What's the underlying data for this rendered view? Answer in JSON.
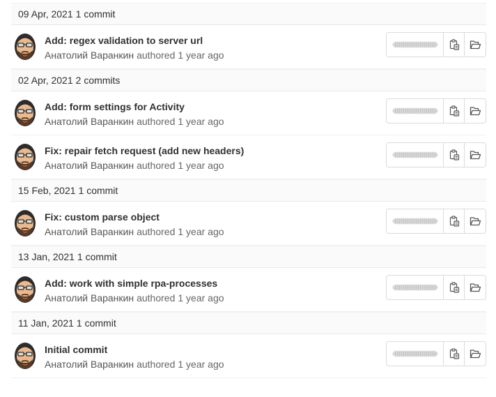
{
  "commit_list": {
    "days": [
      {
        "date": "09 Apr, 2021",
        "count_label": "1 commit",
        "commits": [
          {
            "title": "Add: regex validation to server url",
            "author": "Анатолий Варанкин",
            "verb": "authored",
            "time": "1 year ago"
          }
        ]
      },
      {
        "date": "02 Apr, 2021",
        "count_label": "2 commits",
        "commits": [
          {
            "title": "Add: form settings for Activity",
            "author": "Анатолий Варанкин",
            "verb": "authored",
            "time": "1 year ago"
          },
          {
            "title": "Fix: repair fetch request (add new headers)",
            "author": "Анатолий Варанкин",
            "verb": "authored",
            "time": "1 year ago"
          }
        ]
      },
      {
        "date": "15 Feb, 2021",
        "count_label": "1 commit",
        "commits": [
          {
            "title": "Fix: custom parse object",
            "author": "Анатолий Варанкин",
            "verb": "authored",
            "time": "1 year ago"
          }
        ]
      },
      {
        "date": "13 Jan, 2021",
        "count_label": "1 commit",
        "commits": [
          {
            "title": "Add: work with simple rpa-processes",
            "author": "Анатолий Варанкин",
            "verb": "authored",
            "time": "1 year ago"
          }
        ]
      },
      {
        "date": "11 Jan, 2021",
        "count_label": "1 commit",
        "commits": [
          {
            "title": "Initial commit",
            "author": "Анатолий Варанкин",
            "verb": "authored",
            "time": "1 year ago"
          }
        ]
      }
    ]
  },
  "icons": {
    "copy": "clipboard-copy-icon",
    "browse": "folder-open-icon",
    "avatar": "bearded-man-avatar"
  },
  "colors": {
    "header_bg": "#fafafa",
    "border": "#dbdbdb",
    "title_text": "#303030",
    "meta_text": "#666666"
  }
}
